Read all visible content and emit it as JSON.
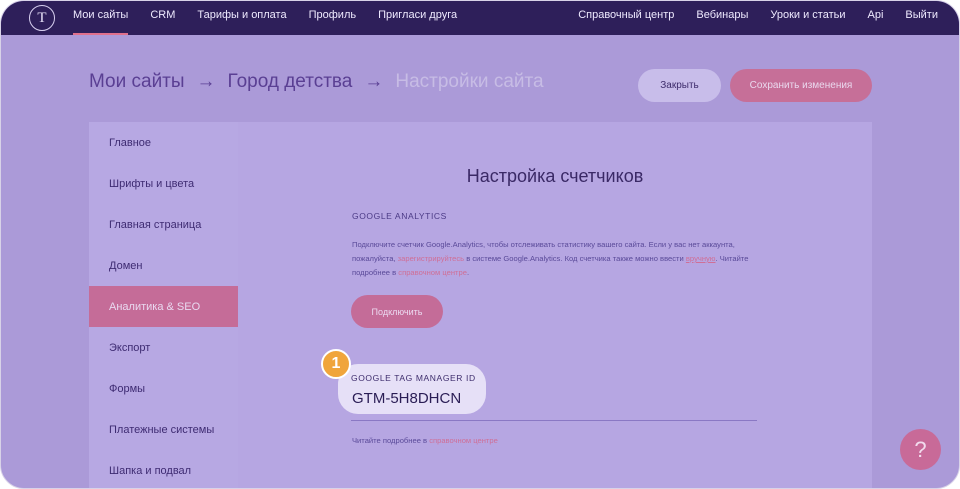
{
  "topnav": {
    "logo": "T",
    "left": [
      "Мои сайты",
      "CRM",
      "Тарифы и оплата",
      "Профиль",
      "Пригласи друга"
    ],
    "right": [
      "Справочный центр",
      "Вебинары",
      "Уроки и статьи",
      "Api",
      "Выйти"
    ]
  },
  "breadcrumb": {
    "item1": "Мои сайты",
    "sep": "→",
    "item2": "Город детства",
    "item3": "Настройки сайта"
  },
  "actions": {
    "close_label": "Закрыть",
    "save_label": "Сохранить изменения"
  },
  "sidebar": {
    "items": [
      {
        "label": "Главное"
      },
      {
        "label": "Шрифты и цвета"
      },
      {
        "label": "Главная страница"
      },
      {
        "label": "Домен"
      },
      {
        "label": "Аналитика & SEO"
      },
      {
        "label": "Экспорт"
      },
      {
        "label": "Формы"
      },
      {
        "label": "Платежные системы"
      },
      {
        "label": "Шапка и подвал"
      }
    ],
    "active_index": 4
  },
  "content": {
    "title": "Настройка счетчиков",
    "ga_label": "GOOGLE ANALYTICS",
    "ga_desc_1": "Подключите счетчик Google.Analytics, чтобы отслеживать статистику вашего сайта. Если у вас нет аккаунта, пожалуйста, ",
    "ga_desc_link1": "зарегистрируйтесь",
    "ga_desc_2": " в системе Google.Analytics. Код счетчика также можно ввести ",
    "ga_desc_link2": "вручную",
    "ga_desc_3": ". Читайте подробнее в ",
    "ga_desc_link3": "справочном центре",
    "ga_desc_4": ".",
    "connect_label": "Подключить",
    "gtm_label": "GOOGLE TAG MANAGER ID",
    "gtm_value": "GTM-5H8DHCN",
    "footnote_text": "Читайте подробнее в ",
    "footnote_link": "справочном центре"
  },
  "callout_number": "1",
  "help_label": "?",
  "colors": {
    "topbar": "#2e1f5a",
    "accent": "#c66f98",
    "overlay": "#ab9ad8",
    "badge": "#f0a53b"
  }
}
